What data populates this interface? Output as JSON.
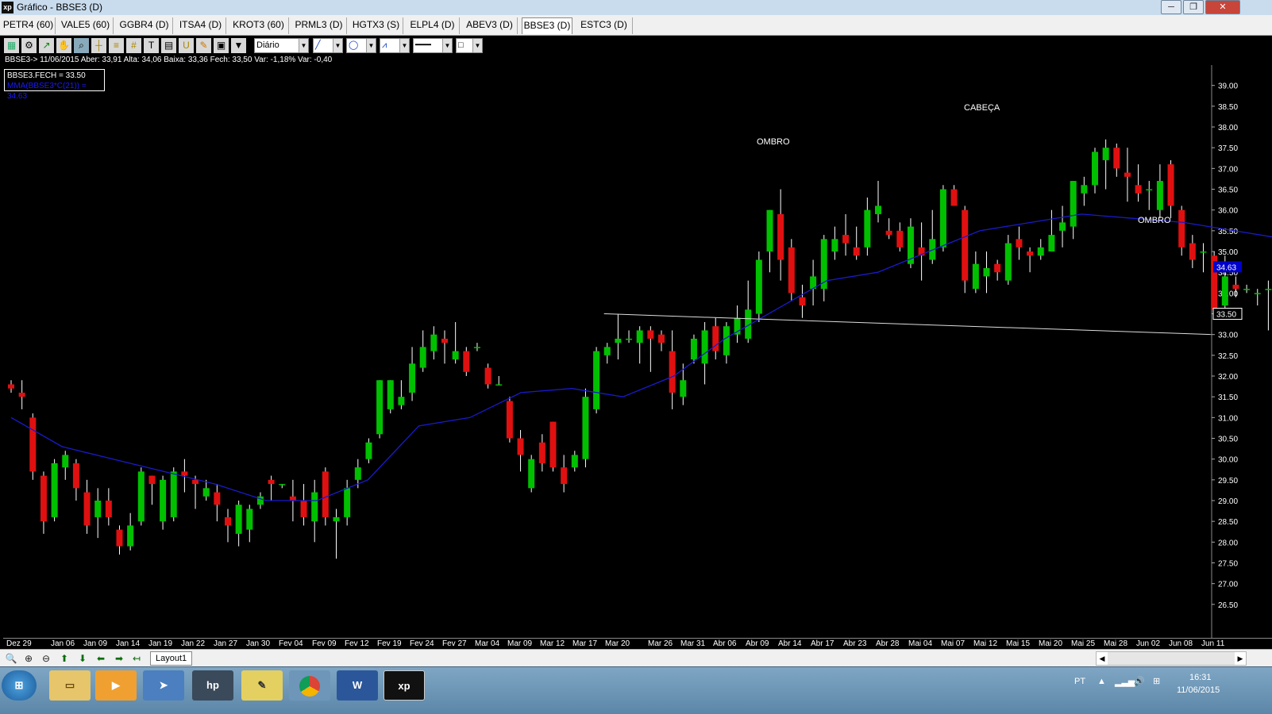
{
  "window": {
    "app_icon": "xp",
    "title": "Gráfico - BBSE3 (D)",
    "controls": [
      "─",
      "❐",
      "✕"
    ]
  },
  "tabs": [
    {
      "label": "PETR4 (60)"
    },
    {
      "label": "VALE5 (60)"
    },
    {
      "label": "GGBR4 (D)"
    },
    {
      "label": "ITSA4 (D)"
    },
    {
      "label": "KROT3 (60)"
    },
    {
      "label": "PRML3 (D)"
    },
    {
      "label": "HGTX3 (S)"
    },
    {
      "label": "ELPL4 (D)"
    },
    {
      "label": "ABEV3 (D)"
    },
    {
      "label": "BBSE3 (D)",
      "active": true
    },
    {
      "label": "ESTC3 (D)"
    }
  ],
  "toolbar": {
    "icons": [
      "chart-icon",
      "gear-icon",
      "arrow-cursor-icon",
      "hand-icon",
      "zoom-area-icon",
      "crosshair-icon",
      "fibonacci-icon",
      "grid-icon",
      "text-icon",
      "calculator-icon",
      "magnet-icon",
      "eraser-icon",
      "clipboard-icon",
      "filter-icon"
    ],
    "period_select": "Diário",
    "line_select": "line-tool-icon",
    "ellipse_select": "ellipse-tool-icon",
    "fan_select": "fan-tool-icon",
    "style_select": "line-style-icon",
    "color_select": "color-icon"
  },
  "info_line": "BBSE3-> 11/06/2015 Aber: 33,91 Alta: 34,06 Baixa: 33,36 Fech: 33,50 Var: -1,18% Var: -0,40",
  "legend": {
    "line1": "BBSE3.FECH = 33.50",
    "line2": "MMA(BBSE3*C(21)) = 34.63",
    "line2_color": "#1a1aff"
  },
  "annotations": [
    {
      "text": "OMBRO"
    },
    {
      "text": "CABEÇA"
    },
    {
      "text": "OMBRO"
    }
  ],
  "colors": {
    "up": "#00c000",
    "down": "#e01010",
    "ma": "#1a1acc",
    "background": "#000000",
    "price_tag": "#0000cc"
  },
  "chart_data": {
    "type": "candlestick",
    "symbol": "BBSE3",
    "period": "Diário",
    "ylim": [
      26.0,
      39.3
    ],
    "y_ticks": [
      "39.00",
      "38.50",
      "38.00",
      "37.50",
      "37.00",
      "36.50",
      "36.00",
      "35.50",
      "35.00",
      "34.50",
      "34.00",
      "33.50",
      "33.00",
      "32.50",
      "32.00",
      "31.50",
      "31.00",
      "30.50",
      "30.00",
      "29.50",
      "29.00",
      "28.50",
      "28.00",
      "27.50",
      "27.00",
      "26.50"
    ],
    "last_price": "33.50",
    "ma_value": "34.63",
    "x_labels": [
      "Dez 29",
      "Jan 06",
      "Jan 09",
      "Jan 14",
      "Jan 19",
      "Jan 22",
      "Jan 27",
      "Jan 30",
      "Fev 04",
      "Fev 09",
      "Fev 12",
      "Fev 19",
      "Fev 24",
      "Fev 27",
      "Mar 04",
      "Mar 09",
      "Mar 12",
      "Mar 17",
      "Mar 20",
      "Mar 26",
      "Mar 31",
      "Abr 06",
      "Abr 09",
      "Abr 14",
      "Abr 17",
      "Abr 23",
      "Abr 28",
      "Mai 04",
      "Mai 07",
      "Mai 12",
      "Mai 15",
      "Mai 20",
      "Mai 25",
      "Mai 28",
      "Jun 02",
      "Jun 08",
      "Jun 11"
    ],
    "candles": [
      [
        31.8,
        31.7,
        31.9,
        31.6
      ],
      [
        31.6,
        31.5,
        31.9,
        31.2
      ],
      [
        31.0,
        29.7,
        31.1,
        29.5
      ],
      [
        29.6,
        28.5,
        29.7,
        28.2
      ],
      [
        28.6,
        29.9,
        30.0,
        28.5
      ],
      [
        29.8,
        30.1,
        30.2,
        29.5
      ],
      [
        29.9,
        29.3,
        30.0,
        29.0
      ],
      [
        29.2,
        28.4,
        29.5,
        28.2
      ],
      [
        28.6,
        29.0,
        29.3,
        28.1
      ],
      [
        29.0,
        28.6,
        29.3,
        28.4
      ],
      [
        28.3,
        27.9,
        28.4,
        27.7
      ],
      [
        27.9,
        28.4,
        28.7,
        27.8
      ],
      [
        28.5,
        29.7,
        29.8,
        28.4
      ],
      [
        29.6,
        29.4,
        29.6,
        28.9
      ],
      [
        28.5,
        29.5,
        29.6,
        28.3
      ],
      [
        28.6,
        29.7,
        29.8,
        28.5
      ],
      [
        29.7,
        29.6,
        30.0,
        29.2
      ],
      [
        29.5,
        29.4,
        29.6,
        28.8
      ],
      [
        29.1,
        29.3,
        29.5,
        29.0
      ],
      [
        29.2,
        28.9,
        29.4,
        28.5
      ],
      [
        28.6,
        28.4,
        28.8,
        28.0
      ],
      [
        28.2,
        28.9,
        29.0,
        27.9
      ],
      [
        28.3,
        28.8,
        28.9,
        28.0
      ],
      [
        28.9,
        29.1,
        29.2,
        28.8
      ],
      [
        29.5,
        29.4,
        29.6,
        29.0
      ],
      [
        29.4,
        29.4,
        29.4,
        29.3
      ],
      [
        29.1,
        29.0,
        29.5,
        28.5
      ],
      [
        29.0,
        28.6,
        29.4,
        28.4
      ],
      [
        28.5,
        29.2,
        29.5,
        28.0
      ],
      [
        29.7,
        28.6,
        29.8,
        28.4
      ],
      [
        28.5,
        28.6,
        28.8,
        27.6
      ],
      [
        28.6,
        29.3,
        29.5,
        28.4
      ],
      [
        29.5,
        29.8,
        30.0,
        29.3
      ],
      [
        30.0,
        30.4,
        30.5,
        29.9
      ],
      [
        30.6,
        31.9,
        31.9,
        30.5
      ],
      [
        31.2,
        31.9,
        31.9,
        31.1
      ],
      [
        31.3,
        31.5,
        31.9,
        31.2
      ],
      [
        31.6,
        32.3,
        32.7,
        31.4
      ],
      [
        32.2,
        32.7,
        33.1,
        32.1
      ],
      [
        32.6,
        33.0,
        33.2,
        32.4
      ],
      [
        32.9,
        32.8,
        33.1,
        32.3
      ],
      [
        32.4,
        32.6,
        33.3,
        32.3
      ],
      [
        32.6,
        32.1,
        32.7,
        32.0
      ],
      [
        32.7,
        32.7,
        32.8,
        32.6
      ],
      [
        32.2,
        31.8,
        32.3,
        31.7
      ],
      [
        31.8,
        31.8,
        32.0,
        31.8
      ],
      [
        31.4,
        30.5,
        31.5,
        30.4
      ],
      [
        30.5,
        30.1,
        30.7,
        29.7
      ],
      [
        29.3,
        30.0,
        30.1,
        29.2
      ],
      [
        30.4,
        29.9,
        30.6,
        29.7
      ],
      [
        30.9,
        29.8,
        30.9,
        29.7
      ],
      [
        29.8,
        29.4,
        30.1,
        29.2
      ],
      [
        29.8,
        30.1,
        30.2,
        29.7
      ],
      [
        30.0,
        31.5,
        31.7,
        29.8
      ],
      [
        31.2,
        32.6,
        32.7,
        31.1
      ],
      [
        32.5,
        32.7,
        32.8,
        32.3
      ],
      [
        32.8,
        32.9,
        33.5,
        32.4
      ],
      [
        32.9,
        32.9,
        33.1,
        32.8
      ],
      [
        32.8,
        33.1,
        33.2,
        32.3
      ],
      [
        33.1,
        32.9,
        33.2,
        32.1
      ],
      [
        33.0,
        32.8,
        33.1,
        32.6
      ],
      [
        32.6,
        31.6,
        33.1,
        31.2
      ],
      [
        31.5,
        31.9,
        32.3,
        31.3
      ],
      [
        32.4,
        32.9,
        33.0,
        32.3
      ],
      [
        32.3,
        33.1,
        33.3,
        31.8
      ],
      [
        33.2,
        32.6,
        33.4,
        32.4
      ],
      [
        32.5,
        33.2,
        33.3,
        32.3
      ],
      [
        33.0,
        33.4,
        33.7,
        32.8
      ],
      [
        32.9,
        33.6,
        34.3,
        32.8
      ],
      [
        33.5,
        34.8,
        35.0,
        33.3
      ],
      [
        35.0,
        36.0,
        36.0,
        34.5
      ],
      [
        35.9,
        34.8,
        36.5,
        34.3
      ],
      [
        35.1,
        34.0,
        35.3,
        33.8
      ],
      [
        33.9,
        33.7,
        34.2,
        33.4
      ],
      [
        34.1,
        34.4,
        34.8,
        33.7
      ],
      [
        34.1,
        35.3,
        35.4,
        33.8
      ],
      [
        35.0,
        35.3,
        35.6,
        34.8
      ],
      [
        35.4,
        35.2,
        35.9,
        34.9
      ],
      [
        35.1,
        34.9,
        35.6,
        34.8
      ],
      [
        35.1,
        36.0,
        36.3,
        34.9
      ],
      [
        35.9,
        36.1,
        36.7,
        35.7
      ],
      [
        35.5,
        35.4,
        35.8,
        35.3
      ],
      [
        35.5,
        35.1,
        35.7,
        35.0
      ],
      [
        34.7,
        35.6,
        35.8,
        34.6
      ],
      [
        35.1,
        34.9,
        35.7,
        34.3
      ],
      [
        34.8,
        35.3,
        36.0,
        34.7
      ],
      [
        35.1,
        36.5,
        36.6,
        35.0
      ],
      [
        36.5,
        36.1,
        36.6,
        36.1
      ],
      [
        36.0,
        34.3,
        36.1,
        34.0
      ],
      [
        34.1,
        34.7,
        35.0,
        34.0
      ],
      [
        34.4,
        34.6,
        35.0,
        34.0
      ],
      [
        34.7,
        34.5,
        34.8,
        34.3
      ],
      [
        34.3,
        35.2,
        35.4,
        34.2
      ],
      [
        35.3,
        35.1,
        35.6,
        34.8
      ],
      [
        35.0,
        34.9,
        35.1,
        34.5
      ],
      [
        34.9,
        35.1,
        35.3,
        34.8
      ],
      [
        35.0,
        35.4,
        36.0,
        35.0
      ],
      [
        35.5,
        35.7,
        36.1,
        35.1
      ],
      [
        35.6,
        36.7,
        36.7,
        35.3
      ],
      [
        36.4,
        36.6,
        36.8,
        36.1
      ],
      [
        36.6,
        37.4,
        37.5,
        36.4
      ],
      [
        37.2,
        37.5,
        37.7,
        36.5
      ],
      [
        37.5,
        37.0,
        37.6,
        36.8
      ],
      [
        36.9,
        36.8,
        37.5,
        36.2
      ],
      [
        36.6,
        36.4,
        37.1,
        36.2
      ],
      [
        36.5,
        36.5,
        36.7,
        36.0
      ],
      [
        36.0,
        36.7,
        37.1,
        35.8
      ],
      [
        37.1,
        36.1,
        37.2,
        35.8
      ],
      [
        36.0,
        35.1,
        36.1,
        34.9
      ],
      [
        35.2,
        34.8,
        35.4,
        34.6
      ],
      [
        35.0,
        35.0,
        35.2,
        34.5
      ],
      [
        34.9,
        33.6,
        35.0,
        33.5
      ],
      [
        33.7,
        34.4,
        34.9,
        33.6
      ],
      [
        34.2,
        34.1,
        34.4,
        33.9
      ],
      [
        34.1,
        34.1,
        34.2,
        34.0
      ],
      [
        34.0,
        34.0,
        34.1,
        33.7
      ],
      [
        34.1,
        34.1,
        34.3,
        33.1
      ],
      [
        34.0,
        33.4,
        34.1,
        33.2
      ],
      [
        33.4,
        33.2,
        33.6,
        33.1
      ],
      [
        33.4,
        33.6,
        33.7,
        33.1
      ],
      [
        33.7,
        34.8,
        35.0,
        33.6
      ],
      [
        34.7,
        34.6,
        35.1,
        34.2
      ],
      [
        34.5,
        34.0,
        34.6,
        34.0
      ],
      [
        34.0,
        34.0,
        34.4,
        33.9
      ],
      [
        34.1,
        34.7,
        34.8,
        33.9
      ],
      [
        34.5,
        33.7,
        34.6,
        33.6
      ],
      [
        34.0,
        34.1,
        34.1,
        32.9
      ],
      [
        33.9,
        33.5,
        34.1,
        33.4
      ]
    ],
    "ma21": [
      [
        31.0,
        31.5
      ],
      [
        30.3,
        30.6
      ],
      [
        30.0,
        29.9
      ],
      [
        29.7,
        29.7
      ],
      [
        29.4,
        29.35
      ],
      [
        29.0,
        29.05
      ],
      [
        29.0,
        29.05
      ],
      [
        29.5,
        29.35
      ],
      [
        30.8,
        30.5
      ],
      [
        31.0,
        30.95
      ],
      [
        31.6,
        31.55
      ],
      [
        31.7,
        31.65
      ],
      [
        31.5,
        31.6
      ],
      [
        32.0,
        31.9
      ],
      [
        32.9,
        32.7
      ],
      [
        33.6,
        33.2
      ],
      [
        34.3,
        34.0
      ],
      [
        34.5,
        34.4
      ],
      [
        35.0,
        34.85
      ],
      [
        35.5,
        35.25
      ],
      [
        35.7,
        35.65
      ],
      [
        35.9,
        35.8
      ],
      [
        35.8,
        35.9
      ],
      [
        35.7,
        35.8
      ],
      [
        35.5,
        35.45
      ],
      [
        35.3,
        35.35
      ],
      [
        34.9,
        35.0
      ],
      [
        34.63,
        34.63
      ]
    ],
    "neckline": [
      [
        33.5,
        33.52
      ],
      [
        32.99,
        33.0
      ]
    ]
  },
  "date_ticks": [
    {
      "label": "Dez 29"
    },
    {
      "label": "Jan 06"
    },
    {
      "label": "Jan 09"
    },
    {
      "label": "Jan 14"
    },
    {
      "label": "Jan 19"
    },
    {
      "label": "Jan 22"
    },
    {
      "label": "Jan 27"
    },
    {
      "label": "Jan 30"
    },
    {
      "label": "Fev 04"
    },
    {
      "label": "Fev 09"
    },
    {
      "label": "Fev 12"
    },
    {
      "label": "Fev 19"
    },
    {
      "label": "Fev 24"
    },
    {
      "label": "Fev 27"
    },
    {
      "label": "Mar 04"
    },
    {
      "label": "Mar 09"
    },
    {
      "label": "Mar 12"
    },
    {
      "label": "Mar 17"
    },
    {
      "label": "Mar 20"
    },
    {
      "label": "Mar 26"
    },
    {
      "label": "Mar 31"
    },
    {
      "label": "Abr 06"
    },
    {
      "label": "Abr 09"
    },
    {
      "label": "Abr 14"
    },
    {
      "label": "Abr 17"
    },
    {
      "label": "Abr 23"
    },
    {
      "label": "Abr 28"
    },
    {
      "label": "Mai 04"
    },
    {
      "label": "Mai 07"
    },
    {
      "label": "Mai 12"
    },
    {
      "label": "Mai 15"
    },
    {
      "label": "Mai 20"
    },
    {
      "label": "Mai 25"
    },
    {
      "label": "Mai 28"
    },
    {
      "label": "Jun 02"
    },
    {
      "label": "Jun 08"
    },
    {
      "label": "Jun 11"
    }
  ],
  "bottom_toolbar": {
    "icons": [
      "zoom-icon",
      "zoom-in-icon",
      "zoom-out-icon",
      "arrow-up-icon",
      "arrow-down-icon",
      "arrow-left-icon",
      "arrow-right-icon",
      "arrow-start-icon"
    ],
    "layout_tab": "Layout1"
  },
  "taskbar": {
    "apps": [
      "start-orb-icon",
      "explorer-icon",
      "media-player-icon",
      "network-app-icon",
      "hp-icon",
      "notes-icon",
      "chrome-icon",
      "word-icon",
      "xp-icon"
    ],
    "word_label": "W",
    "xp_label": "xp",
    "hp_label": "hp",
    "language": "PT",
    "time": "16:31",
    "date": "11/06/2015"
  }
}
